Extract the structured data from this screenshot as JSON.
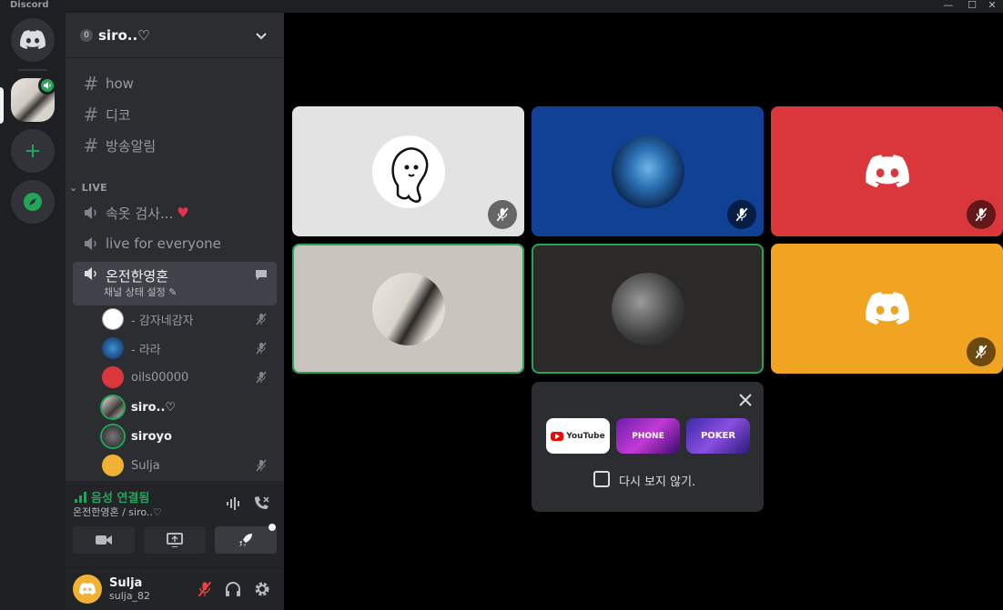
{
  "app": {
    "title": "Discord"
  },
  "guild": {
    "name": "siro..♡",
    "boost_level": "0"
  },
  "channels": [
    {
      "name": "how",
      "type": "text"
    },
    {
      "name": "디코",
      "type": "text"
    },
    {
      "name": "방송알림",
      "type": "text"
    }
  ],
  "category": {
    "name": "LIVE"
  },
  "voice_channels": [
    {
      "name": "속옷 검사...",
      "emoji": "♥"
    },
    {
      "name": "live for everyone"
    },
    {
      "name": "온전한영혼",
      "status_placeholder": "채널 상태 설정",
      "active": true
    }
  ],
  "voice_users": [
    {
      "name": "- 감자네감자",
      "muted": true
    },
    {
      "name": "- 라라",
      "muted": true
    },
    {
      "name": "oils00000",
      "muted": true
    },
    {
      "name": "siro..♡",
      "muted": false
    },
    {
      "name": "siroyo",
      "muted": false
    },
    {
      "name": "Sulja",
      "muted": true
    }
  ],
  "voice_panel": {
    "status": "음성 연결됨",
    "location": "온전한영혼 / siro..♡"
  },
  "user": {
    "name": "Sulja",
    "tag": "sulja_82"
  },
  "tiles": [
    {
      "user": "- 감자네감자",
      "bg": "#e3e3e3",
      "muted": true,
      "speaking": false
    },
    {
      "user": "- 라라",
      "bg": "#114194",
      "muted": true,
      "speaking": false
    },
    {
      "user": "oils00000",
      "bg": "#da373c",
      "muted": true,
      "speaking": false
    },
    {
      "user": "siro..♡",
      "bg": "#c9c4bd",
      "muted": false,
      "speaking": true
    },
    {
      "user": "siroyo",
      "bg": "#2b2a29",
      "muted": false,
      "speaking": true
    },
    {
      "user": "Sulja",
      "bg": "#f0a422",
      "muted": true,
      "speaking": false
    }
  ],
  "activity_popup": {
    "activities": [
      {
        "name": "YouTube",
        "label": "YouTube"
      },
      {
        "name": "Gartic Phone",
        "label": "PHONE"
      },
      {
        "name": "Poker Night",
        "label": "POKER"
      }
    ],
    "dont_show_again": "다시 보지 않기."
  },
  "colors": {
    "accent": "#5865f2",
    "speaking": "#23a559",
    "sidebar": "#2b2d31",
    "rail": "#1e1f22"
  }
}
